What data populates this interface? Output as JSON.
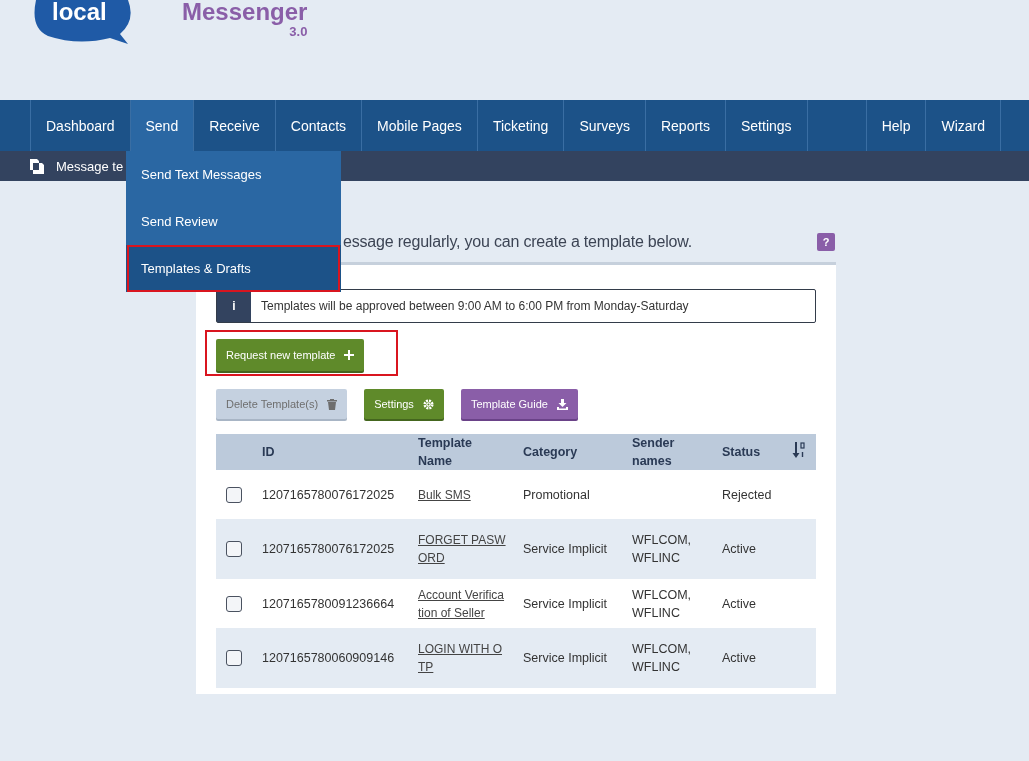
{
  "logo": {
    "word": "local",
    "product": "Messenger",
    "version": "3.0"
  },
  "nav": {
    "items": [
      {
        "label": "Dashboard",
        "selected": false
      },
      {
        "label": "Send",
        "selected": true
      },
      {
        "label": "Receive",
        "selected": false
      },
      {
        "label": "Contacts",
        "selected": false
      },
      {
        "label": "Mobile Pages",
        "selected": false
      },
      {
        "label": "Ticketing",
        "selected": false
      },
      {
        "label": "Surveys",
        "selected": false
      },
      {
        "label": "Reports",
        "selected": false
      },
      {
        "label": "Settings",
        "selected": false
      }
    ],
    "right_items": [
      {
        "label": "Help",
        "selected": false
      },
      {
        "label": "Wizard",
        "selected": false
      }
    ]
  },
  "dropdown": [
    {
      "label": "Send Text Messages",
      "selected": false,
      "highlighted": false
    },
    {
      "label": "Send Review",
      "selected": false,
      "highlighted": false
    },
    {
      "label": "Templates & Drafts",
      "selected": true,
      "highlighted": true
    }
  ],
  "breadcrumb": "Message te",
  "intro": "essage regularly, you can create a template below.",
  "help": "?",
  "info": {
    "icon": "i",
    "text": "Templates will be approved between 9:00 AM to 6:00 PM from Monday-Saturday"
  },
  "request_button": {
    "label": "Request new template",
    "highlighted": true
  },
  "actions": [
    {
      "label": "Delete Template(s)",
      "kind": "delete",
      "disabled": true
    },
    {
      "label": "Settings",
      "kind": "settings",
      "disabled": false
    },
    {
      "label": "Template Guide",
      "kind": "guide",
      "disabled": false
    }
  ],
  "table": {
    "columns": [
      "ID",
      "Template Name",
      "Category",
      "Sender names",
      "Status"
    ],
    "rows": [
      {
        "checked": false,
        "id": "1207165780076172025",
        "name": "Bulk SMS",
        "category": "Promotional",
        "senders": "",
        "status": "Rejected"
      },
      {
        "checked": false,
        "id": "1207165780076172025",
        "name": "FORGET PASWORD",
        "category": "Service Implicit",
        "senders": "WFLCOM, WFLINC",
        "status": "Active"
      },
      {
        "checked": false,
        "id": "1207165780091236664",
        "name": "Account Verification of Seller",
        "category": "Service Implicit",
        "senders": "WFLCOM, WFLINC",
        "status": "Active"
      },
      {
        "checked": false,
        "id": "1207165780060909146",
        "name": "LOGIN WITH OTP",
        "category": "Service Implicit",
        "senders": "WFLCOM, WFLINC",
        "status": "Active"
      }
    ]
  }
}
